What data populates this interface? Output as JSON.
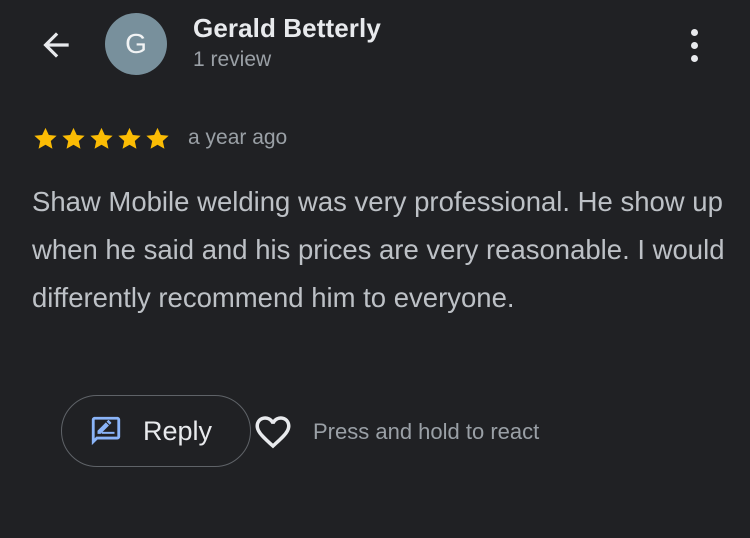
{
  "header": {
    "avatar_initial": "G",
    "avatar_color": "#78909c",
    "reviewer_name": "Gerald Betterly",
    "review_count": "1 review",
    "back_icon": "arrow-left-icon",
    "more_icon": "more-vert-icon"
  },
  "review": {
    "rating": 5,
    "rating_max": 5,
    "star_color": "#fbbc04",
    "time_ago": "a year ago",
    "text": "Shaw Mobile welding was very professional. He show up when he said and his prices are very reasonable. I would differently recommend him to everyone."
  },
  "actions": {
    "reply_label": "Reply",
    "reply_icon": "reply-edit-icon",
    "reply_icon_color": "#8ab4f8",
    "heart_icon": "heart-outline-icon",
    "react_hint": "Press and hold to react"
  }
}
